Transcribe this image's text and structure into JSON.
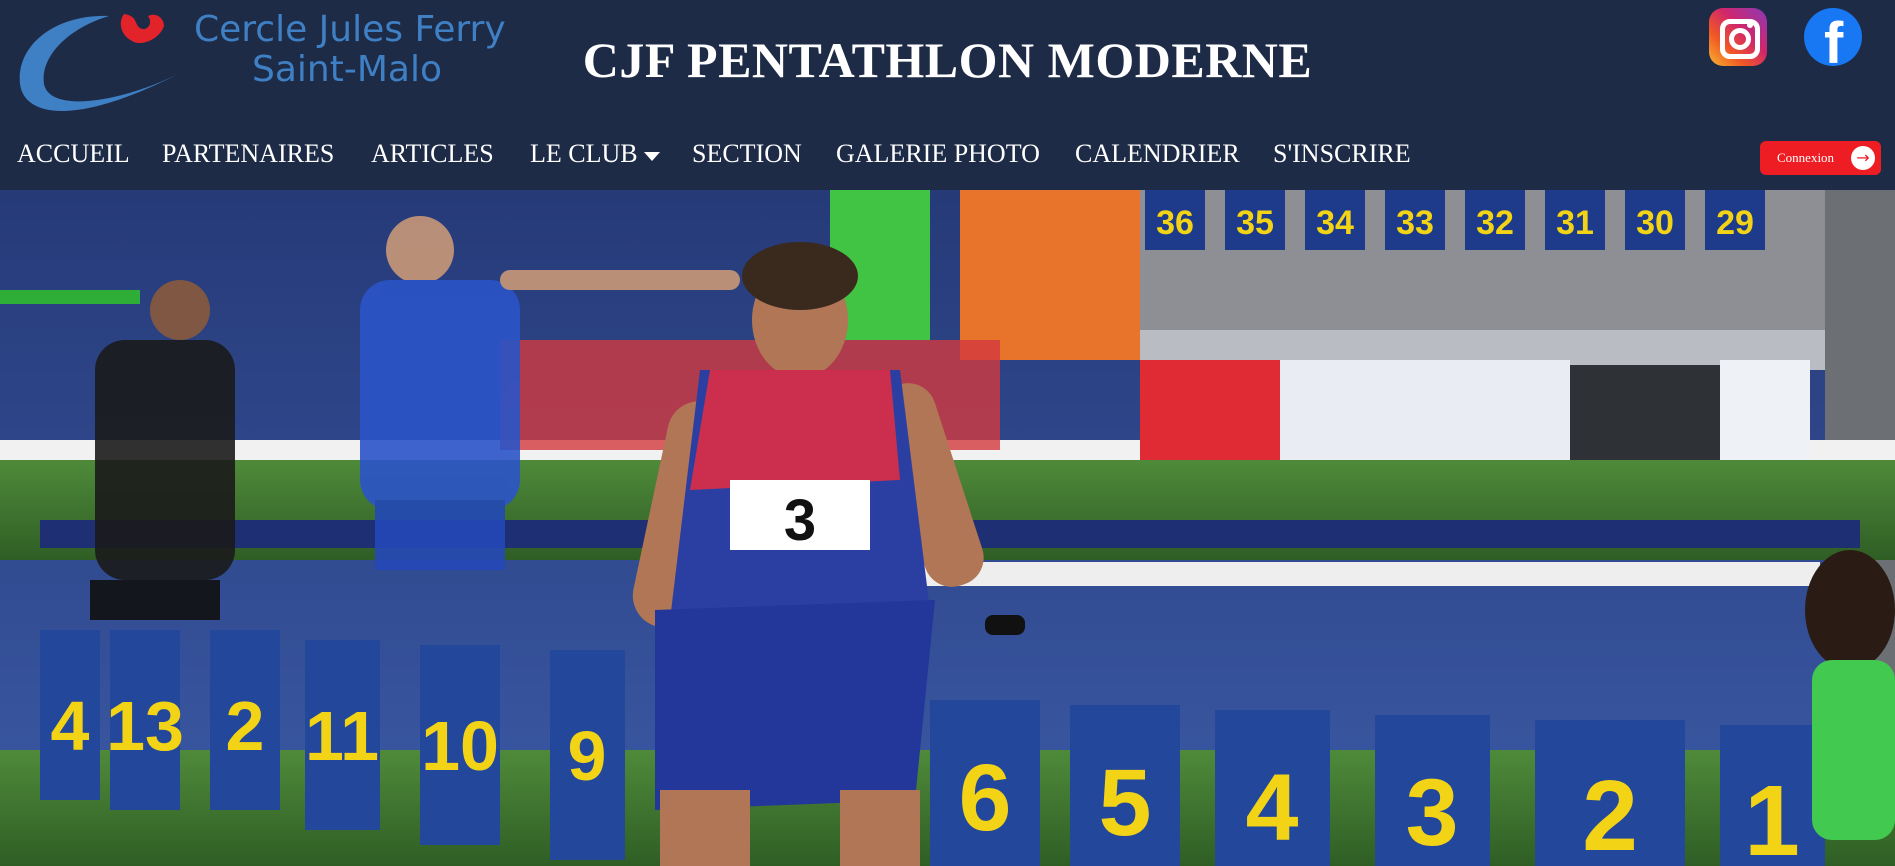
{
  "brand": {
    "logo_line1": "Cercle Jules Ferry",
    "logo_line2": "Saint-Malo",
    "site_title": "CJF PENTATHLON MODERNE"
  },
  "social": [
    {
      "name": "instagram",
      "icon": "instagram-icon"
    },
    {
      "name": "facebook",
      "icon": "facebook-icon",
      "glyph": "f"
    }
  ],
  "nav": {
    "items": [
      {
        "label": "ACCUEIL"
      },
      {
        "label": "PARTENAIRES"
      },
      {
        "label": "ARTICLES"
      },
      {
        "label": "LE CLUB",
        "has_dropdown": true
      },
      {
        "label": "SECTION"
      },
      {
        "label": "GALERIE PHOTO"
      },
      {
        "label": "CALENDRIER"
      },
      {
        "label": "S'INSCRIRE"
      }
    ]
  },
  "login": {
    "label": "Connexion",
    "arrow": "→"
  },
  "hero": {
    "bib_main": "3",
    "lane_numbers": [
      "6",
      "5",
      "4",
      "3",
      "2",
      "1"
    ],
    "bg_lane_numbers": [
      "4",
      "13",
      "2",
      "11",
      "10",
      "9"
    ],
    "top_board_numbers": [
      "36",
      "35",
      "34",
      "33",
      "32",
      "31",
      "30",
      "29"
    ]
  },
  "colors": {
    "header_bg": "#1e2b47",
    "logo_blue": "#3f7fc4",
    "logo_red": "#e2242a",
    "login_red": "#ee1d23",
    "lane_board_blue": "#23479a",
    "lane_number_yellow": "#f3d316"
  }
}
